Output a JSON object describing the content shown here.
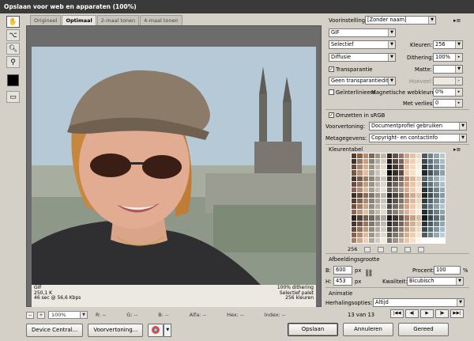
{
  "window": {
    "title": "Opslaan voor web en apparaten (100%)"
  },
  "tabs": [
    {
      "label": "Origineel",
      "active": false
    },
    {
      "label": "Optimaal",
      "active": true
    },
    {
      "label": "2-maal tonen",
      "active": false
    },
    {
      "label": "4-maal tonen",
      "active": false
    }
  ],
  "tools": [
    "hand-icon",
    "slice-select-icon",
    "zoom-icon",
    "eyedropper-icon"
  ],
  "colors": {
    "eyedropper_swatch": "#000000",
    "accent": "#3a3a3a"
  },
  "image_info": {
    "format": "GIF",
    "size": "250,1 K",
    "download": "46 sec @ 56,6 Kbps",
    "dither": "100% dithering",
    "palette": "Selectief palet",
    "colors": "256 kleuren"
  },
  "statusbar": {
    "zoom": "100%",
    "r": "R: --",
    "g": "G: --",
    "b": "B: --",
    "alfa": "Alfa: --",
    "hex": "Hex: --",
    "index": "Index: --"
  },
  "buttons": {
    "device_central": "Device Central...",
    "preview": "Voorvertoning...",
    "save": "Opslaan",
    "cancel": "Annuleren",
    "done": "Gereed"
  },
  "settings": {
    "preset_label": "Voorinstelling:",
    "preset_value": "[Zonder naam]",
    "format_value": "GIF",
    "reduction_value": "Selectief",
    "colors_label": "Kleuren:",
    "colors_value": "256",
    "dither_value": "Diffusie",
    "dithering_label": "Dithering:",
    "dithering_value": "100%",
    "transparency_label": "Transparantie",
    "transparency_checked": true,
    "matte_label": "Matte:",
    "trans_dither_value": "Geen transparantiedit...",
    "amount_label": "Hoeveel:",
    "interlaced_label": "Geïnterlinieerd",
    "interlaced_checked": false,
    "web_snap_label": "Magnetische webkleuren:",
    "web_snap_value": "0%",
    "lossy_label": "Met verlies:",
    "lossy_value": "0",
    "srgb_label": "Omzetten in sRGB",
    "srgb_checked": true,
    "preview_label": "Voorvertoning:",
    "preview_value": "Documentprofiel gebruiken",
    "metadata_label": "Metagegevens:",
    "metadata_value": "Copyright- en contactinfo"
  },
  "color_table": {
    "title": "Kleurentabel",
    "count": "256",
    "swatches": [
      "#5b3a2c",
      "#8a5d45",
      "#b98a6d",
      "#7e6a5a",
      "#a3917f",
      "#c7b4a1",
      "#2f2a27",
      "#6b5144",
      "#94776a",
      "#d0a488",
      "#e5c2a4",
      "#f0d7bf",
      "#4b5b60",
      "#6f8088",
      "#93a6b0",
      "#b6c8d1",
      "#3d3129",
      "#9c7760",
      "#c79f80",
      "#8a8277",
      "#b5ab9c",
      "#d7cdbe",
      "#201c1a",
      "#5a463b",
      "#7d6252",
      "#e0b193",
      "#f3ceae",
      "#f8e4cf",
      "#3b4a50",
      "#5d6f78",
      "#809399",
      "#a5bcc6",
      "#6a4837",
      "#ab8368",
      "#d6ae8e",
      "#9b9285",
      "#c2b8aa",
      "#e3dbcd",
      "#151311",
      "#453730",
      "#6e5547",
      "#e9bd9f",
      "#f5d9bd",
      "#faeedd",
      "#2c383d",
      "#4f6068",
      "#728690",
      "#96aeb9",
      "#80553f",
      "#bb9175",
      "#e2bd9e",
      "#a9a093",
      "#cbc3b5",
      "#ebe4d8",
      "#0b0a09",
      "#382d27",
      "#62493d",
      "#f1c7aa",
      "#f7e0c8",
      "#fdf4e7",
      "#1f292d",
      "#425258",
      "#657981",
      "#89a1ab",
      "#4e362b",
      "#7a5745",
      "#a57c63",
      "#8c857b",
      "#aea69a",
      "#cfc8bc",
      "#33302d",
      "#574a42",
      "#7b6659",
      "#c49476",
      "#dfb697",
      "#edd0b5",
      "#55646a",
      "#77898f",
      "#9aadb5",
      "#bccfd8",
      "#6e4a3a",
      "#98705a",
      "#c39a7c",
      "#9a9388",
      "#bdb5a8",
      "#ddd6c9",
      "#4a4642",
      "#6e6158",
      "#927d70",
      "#d09f80",
      "#e9c3a4",
      "#f4dcc4",
      "#3e4c52",
      "#617178",
      "#849aa2",
      "#a8c0ca",
      "#8e5f49",
      "#b68a6f",
      "#dcb699",
      "#a69f94",
      "#c8c0b3",
      "#e8e1d5",
      "#625d58",
      "#85786e",
      "#a99384",
      "#daaa8a",
      "#f0cdb0",
      "#f9e6d2",
      "#2a3539",
      "#4c5c62",
      "#6f848c",
      "#93aab4",
      "#3f2c23",
      "#664839",
      "#8e6a55",
      "#7a756e",
      "#9c958a",
      "#beb6a9",
      "#242220",
      "#4b4039",
      "#6f5b4f",
      "#b8896d",
      "#d2a98b",
      "#e4c4a8",
      "#1c2528",
      "#3e4c51",
      "#61747b",
      "#8499a3",
      "#5a3f31",
      "#84624f",
      "#ae896d",
      "#87827b",
      "#a9a399",
      "#cbc4b8",
      "#393633",
      "#605349",
      "#856f62",
      "#c6977a",
      "#deb99c",
      "#eed4ba",
      "#303d42",
      "#53656c",
      "#768b93",
      "#99b2bd",
      "#754f3d",
      "#a07a61",
      "#cba585",
      "#938d83",
      "#b5ae9f",
      "#d6cfc1",
      "#504b47",
      "#756860",
      "#9a8577",
      "#d4a586",
      "#ebc8aa",
      "#f6e1ca",
      "#43535a",
      "#66787f",
      "#8a9fa7",
      "#adc5cf",
      "#936650",
      "#bf957a",
      "#e5c1a3",
      "#a0998e",
      "#c2bbad",
      "#e2dbce",
      "#686460",
      "#8d8077",
      "#b19d8f",
      "#dfb394",
      "#f2d2b6",
      "#fbeada",
      "#263034",
      "#48585e",
      "#6b7f87",
      "#8ea5af",
      "#2d211c",
      "#533c31",
      "#7b5c4b",
      "#6a6660",
      "#8c8680",
      "#aea79b",
      "#181716",
      "#3e352f",
      "#634f44",
      "#a77e65",
      "#c39f84",
      "#dbbca1",
      "#121a1d",
      "#34424a",
      "#576970",
      "#7a8f98",
      "#4a352a",
      "#725443",
      "#9b765e",
      "#7c7872",
      "#9e988e",
      "#c0b9ad",
      "#2d2b29",
      "#54483f",
      "#796557",
      "#b68d71",
      "#d3af92",
      "#e8ccb2",
      "#27353a",
      "#4a5b61",
      "#6d8088",
      "#90a7b1",
      "#694835",
      "#946e57",
      "#bf9877",
      "#8f8a82",
      "#b1aa9e",
      "#d3ccbf",
      "#44403c",
      "#6a5d54",
      "#8f7a6c",
      "#c79b7d",
      "#e1bfa2",
      "#f2d9c0",
      "#394950",
      "#5c6e75",
      "#7f959d",
      "#a2bcc7",
      "#8b604a",
      "#b68b6e",
      "#dfba9c",
      "#9d978c",
      "#bfb8ab",
      "#e0d9cc",
      "#5b5753",
      "#81746a",
      "#a6907f",
      "#d8ad8e",
      "#eecdaf",
      "#f8e5d0",
      "#4c5d63",
      "#6f8389",
      "#92a9b1",
      "#b5d0da",
      "#a87b62",
      "#d0a688",
      "#efcfb3",
      "#b0aa9e",
      "#d2cbbd",
      "#f1ebdf",
      "#7a7570",
      "#9f9186",
      "#c4ad9c",
      "#eac5a7",
      "#f7dfc6",
      "#fff4e6"
    ]
  },
  "image_size": {
    "title": "Afbeeldingsgrootte",
    "w_label": "B:",
    "w_value": "600",
    "h_label": "H:",
    "h_value": "453",
    "unit": "px",
    "percent_label": "Procent:",
    "percent_value": "100",
    "percent_unit": "%",
    "quality_label": "Kwaliteit:",
    "quality_value": "Bicubisch"
  },
  "animation": {
    "title": "Animatie",
    "loop_label": "Herhalingsopties:",
    "loop_value": "Altijd",
    "frame": "13 van 13"
  }
}
